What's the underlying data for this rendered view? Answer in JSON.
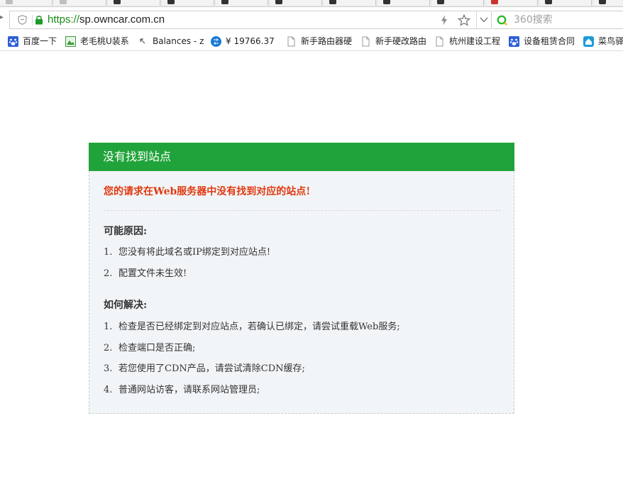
{
  "browser": {
    "url": {
      "scheme": "https://",
      "host": "sp.owncar.com.cn"
    },
    "search": {
      "placeholder": "360搜索"
    },
    "bookmarks": [
      {
        "label": "百度一下",
        "icon": "baidu-paw-icon"
      },
      {
        "label": "老毛桃U装系",
        "icon": "image-icon"
      },
      {
        "label": "Balances - z",
        "icon": "cursor-icon"
      },
      {
        "label": "¥ 19766.37",
        "icon": "exchange-icon"
      },
      {
        "label": "新手路由器硬",
        "icon": "page-icon"
      },
      {
        "label": "新手硬改路由",
        "icon": "page-icon"
      },
      {
        "label": "杭州建设工程",
        "icon": "page-icon"
      },
      {
        "label": "设备租赁合同",
        "icon": "baidu-paw-icon"
      },
      {
        "label": "菜鸟驿",
        "icon": "home-icon"
      }
    ]
  },
  "error_page": {
    "title": "没有找到站点",
    "headline": "您的请求在Web服务器中没有找到对应的站点!",
    "causes": {
      "heading": "可能原因:",
      "items": [
        {
          "num": "1.",
          "text": "您没有将此域名或IP绑定到对应站点!"
        },
        {
          "num": "2.",
          "text": "配置文件未生效!"
        }
      ]
    },
    "solutions": {
      "heading": "如何解决:",
      "items": [
        {
          "num": "1.",
          "text": "检查是否已经绑定到对应站点，若确认已绑定，请尝试重载Web服务;"
        },
        {
          "num": "2.",
          "text": "检查端口是否正确;"
        },
        {
          "num": "3.",
          "text": "若您使用了CDN产品，请尝试清除CDN缓存;"
        },
        {
          "num": "4.",
          "text": "普通网站访客，请联系网站管理员;"
        }
      ]
    }
  },
  "colors": {
    "header_green": "#21a33b",
    "headline_red": "#e0380e",
    "panel_bg": "#f2f5f8"
  }
}
